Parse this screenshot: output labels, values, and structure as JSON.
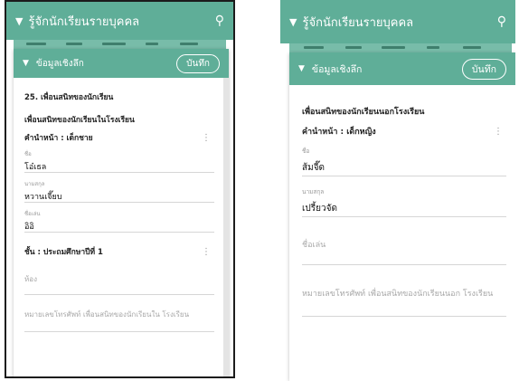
{
  "left": {
    "appbar": {
      "title": "รู้จักนักเรียนรายบุคคล"
    },
    "card": {
      "header": {
        "title": "ข้อมูลเชิงลึก",
        "save_label": "บันทึก"
      },
      "section_title": "25. เพื่อนสนิทของนักเรียน",
      "subsection_title": "เพื่อนสนิทของนักเรียนในโรงเรียน",
      "prefix_label": "คำนำหน้า : เด็กชาย",
      "first_name": {
        "label": "ชื่อ",
        "value": "โอ๋เธล"
      },
      "last_name": {
        "label": "นามสกุล",
        "value": "หวานเจี๊ยบ"
      },
      "nickname": {
        "label": "ชื่อเล่น",
        "value": "อิอิ"
      },
      "grade_label": "ชั้น : ประถมศึกษาปีที่ 1",
      "room": {
        "placeholder": "ห้อง"
      },
      "phone": {
        "placeholder": "หมายเลขโทรศัพท์ เพื่อนสนิทของนักเรียนใน โรงเรียน"
      }
    }
  },
  "right": {
    "appbar": {
      "title": "รู้จักนักเรียนรายบุคคล"
    },
    "card": {
      "header": {
        "title": "ข้อมูลเชิงลึก",
        "save_label": "บันทึก"
      },
      "subsection_title": "เพื่อนสนิทของนักเรียนนอกโรงเรียน",
      "prefix_label": "คำนำหน้า : เด็กหญิง",
      "first_name": {
        "label": "ชื่อ",
        "value": "ส้มจี๊ด"
      },
      "last_name": {
        "label": "นามสกุล",
        "value": "เปรี้ยวจัด"
      },
      "nickname": {
        "placeholder": "ชื่อเล่น"
      },
      "phone": {
        "placeholder": "หมายเลขโทรศัพท์ เพื่อนสนิทของนักเรียนนอก โรงเรียน"
      }
    }
  },
  "colors": {
    "accent": "#5fae98",
    "text": "#222222",
    "hint": "#9a9a9a"
  },
  "icons": {
    "appbar_left": "chevron-down-icon",
    "appbar_right": "search-icon",
    "row_menu": "kebab-icon"
  }
}
